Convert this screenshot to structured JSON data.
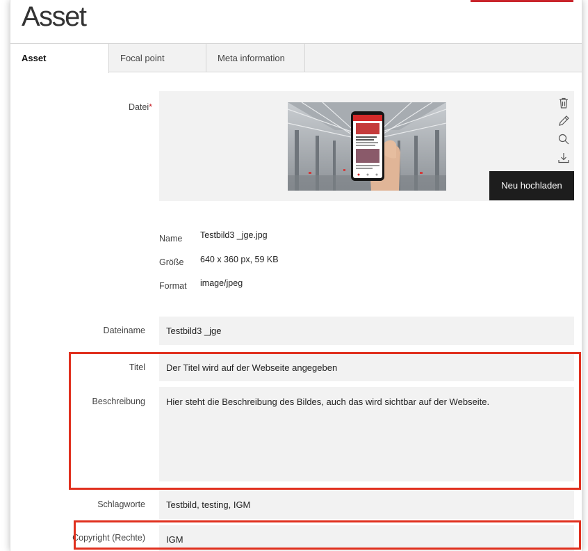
{
  "page": {
    "title": "Asset"
  },
  "tabs": [
    {
      "label": "Asset",
      "active": true
    },
    {
      "label": "Focal point",
      "active": false
    },
    {
      "label": "Meta information",
      "active": false
    }
  ],
  "file": {
    "label": "Datei",
    "required_mark": "*",
    "upload_button": "Neu hochladen",
    "tools": [
      "trash-icon",
      "pencil-icon",
      "search-icon",
      "download-icon"
    ],
    "info": {
      "name_key": "Name",
      "name_value": "Testbild3 _jge.jpg",
      "size_key": "Größe",
      "size_value": "640 x 360 px, 59 KB",
      "format_key": "Format",
      "format_value": "image/jpeg"
    }
  },
  "fields": {
    "filename": {
      "label": "Dateiname",
      "value": "Testbild3 _jge"
    },
    "title": {
      "label": "Titel",
      "value": "Der Titel wird auf der Webseite angegeben"
    },
    "description": {
      "label": "Beschreibung",
      "value": "Hier steht die Beschreibung des Bildes, auch das wird sichtbar auf der Webseite."
    },
    "keywords": {
      "label": "Schlagworte",
      "value": "Testbild, testing, IGM"
    },
    "copyright": {
      "label": "Copyright (Rechte)",
      "value": "IGM"
    }
  },
  "colors": {
    "accent": "#c9252c",
    "highlight": "#e0301e",
    "field_bg": "#f2f2f2",
    "button_bg": "#1d1d1d"
  }
}
